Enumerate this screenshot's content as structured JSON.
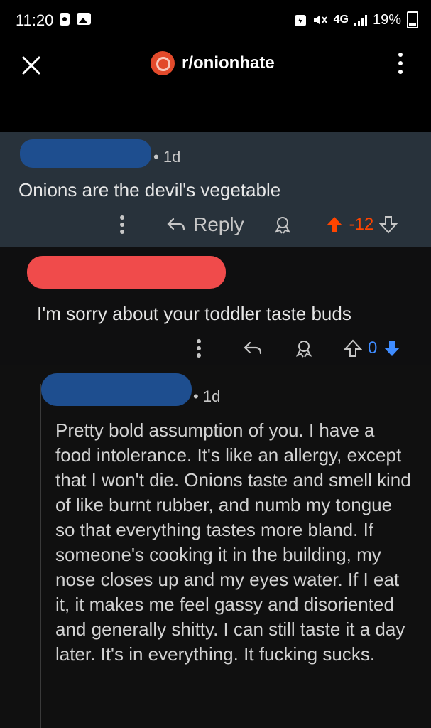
{
  "status_bar": {
    "time": "11:20",
    "network": "4G",
    "battery": "19%"
  },
  "header": {
    "subreddit": "r/onionhate"
  },
  "comments": [
    {
      "author_redacted": true,
      "age": "1d",
      "text": "Onions are the devil's vegetable",
      "reply_label": "Reply",
      "score": "-12",
      "upvote_color": "#ff4500"
    },
    {
      "author_redacted": true,
      "text": "I'm sorry about your toddler taste buds",
      "score": "0",
      "downvote_color": "#3f8cff"
    },
    {
      "author_redacted": true,
      "age": "1d",
      "text": "Pretty bold assumption of you.  I have a food intolerance.  It's like an allergy, except that I won't die.  Onions taste and smell kind of like burnt rubber, and numb my tongue so that everything tastes more bland.  If someone's cooking it in the building, my nose closes up and my eyes water.  If I eat it, it makes me feel gassy and disoriented and generally shitty.  I can still taste it a day later.  It's in everything.  It fucking sucks."
    }
  ]
}
